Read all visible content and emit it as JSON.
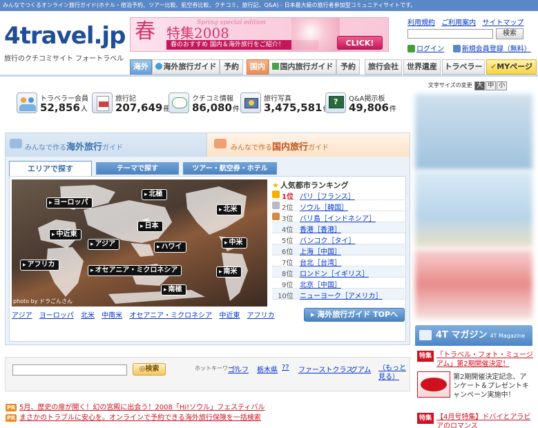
{
  "topbar": {
    "text": "みんなでつくるオンライン旅行ガイド(ホテル・宿泊予約、ツアー比較、航空券比較、クチコミ、旅行記、Q&A) - 日本最大級の旅行者参加型コミュニティサイトです。"
  },
  "logo": {
    "text": "4travel.jp",
    "subtitle": "旅行のクチコミサイト フォートラベル"
  },
  "banner": {
    "big": "春",
    "title": "特集2008",
    "english": "Spring special edition",
    "subtitle": "春のおすすめ 国内＆海外旅行をご紹介！",
    "click": "CLICK!"
  },
  "toplinks": [
    "利用規約",
    "ご利用案内",
    "サイトマップ"
  ],
  "top_search": {
    "button": "検索",
    "placeholder": ""
  },
  "login": {
    "login": "ログイン",
    "register": "新規会員登録（無料）"
  },
  "nav": {
    "overseas_label": "海外",
    "overseas_guide": "海外旅行ガイド",
    "overseas_reserve": "予約",
    "domestic_label": "国内",
    "domestic_guide": "国内旅行ガイド",
    "domestic_reserve": "予約",
    "company": "旅行会社",
    "heritage": "世界遺産",
    "traveler": "トラベラー",
    "mypage": "MYページ"
  },
  "fontsize": {
    "label": "文字サイズの変更",
    "large": "大",
    "medium": "中",
    "small": "小"
  },
  "stats": [
    {
      "label": "トラベラー会員",
      "value": "52,856",
      "unit": "人",
      "icon": "members-icon"
    },
    {
      "label": "旅行記",
      "value": "207,649",
      "unit": "冊",
      "icon": "travelogue-icon"
    },
    {
      "label": "クチコミ情報",
      "value": "86,080",
      "unit": "件",
      "icon": "review-icon"
    },
    {
      "label": "旅行写真",
      "value": "3,475,581",
      "unit": "件",
      "icon": "photo-icon"
    },
    {
      "label": "Q&A掲示板",
      "value": "49,806",
      "unit": "件",
      "icon": "qa-icon"
    }
  ],
  "guide": {
    "overseas_tab_pre": "みんなで作る",
    "overseas_tab_main": "海外旅行",
    "overseas_tab_post": "ガイド",
    "domestic_tab_pre": "みんなで作る",
    "domestic_tab_main": "国内旅行",
    "domestic_tab_post": "ガイド",
    "subtabs": [
      "エリアで探す",
      "テーマで探す",
      "ツアー・航空券・ホテル"
    ]
  },
  "map": {
    "labels": [
      "ヨーロッパ",
      "北極",
      "北米",
      "日本",
      "中近東",
      "アジア",
      "ハワイ",
      "中米",
      "アフリカ",
      "オセアニア・ミクロネシア",
      "南米",
      "南極"
    ],
    "photo_credit": "photo by ドラごんさん"
  },
  "arealinks": [
    "アジア",
    "ヨーロッパ",
    "北米",
    "中南米",
    "オセアニア・ミクロネシア",
    "中近東",
    "アフリカ"
  ],
  "ranking": {
    "title": "人気都市ランキング",
    "items": [
      {
        "rank": "1位",
        "city": "パリ［フランス］"
      },
      {
        "rank": "2位",
        "city": "ソウル［韓国］"
      },
      {
        "rank": "3位",
        "city": "バリ島［インドネシア］"
      },
      {
        "rank": "4位",
        "city": "香港［香港］"
      },
      {
        "rank": "5位",
        "city": "バンコク［タイ］"
      },
      {
        "rank": "6位",
        "city": "上海［中国］"
      },
      {
        "rank": "7位",
        "city": "台北［台湾］"
      },
      {
        "rank": "8位",
        "city": "ロンドン［イギリス］"
      },
      {
        "rank": "9位",
        "city": "北京［中国］"
      },
      {
        "rank": "10位",
        "city": "ニューヨーク［アメリカ］"
      }
    ],
    "top_button": "海外旅行ガイド TOPへ"
  },
  "bottom_search": {
    "button": "検索",
    "hot_label": "ホットキーワード",
    "keywords": [
      "ゴルフ",
      "栃木県",
      "??",
      "ファーストクラス",
      "グアム"
    ],
    "more": "（もっと見る）"
  },
  "promos": [
    {
      "tag": "PR",
      "text": "5月、歴史の扉が開く！幻の宮殿に出会う！2008「Hi!ソウル」フェスティバル"
    },
    {
      "tag": "PR",
      "text": "まさかのトラブルに安心を。オンラインで予約できる海外旅行保険を一括検索"
    }
  ],
  "magazine": {
    "title": "4T マガジン",
    "sub": "4T Magazine"
  },
  "features": [
    {
      "tag": "特集",
      "title": "「トラベル・フォト・ミュージアム」第2期開催決定！",
      "text": "第2期開催決定記念、アンケート＆プレゼントキャンペーン実施中！"
    },
    {
      "tag": "特集",
      "title": "【4月号特集】ドバイとアラビアのロマンス",
      "text": ""
    }
  ],
  "colors": {
    "header_blue": "#5a87c5",
    "accent_red": "#d0101f",
    "link": "#0033cc"
  }
}
